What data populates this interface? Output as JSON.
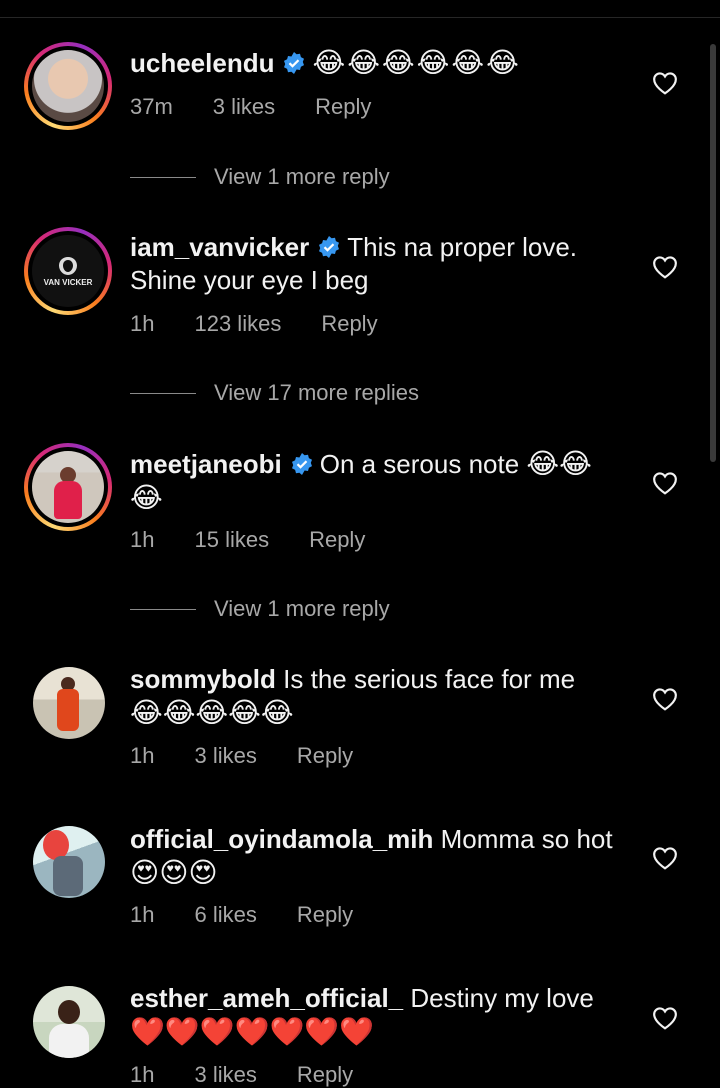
{
  "comments": [
    {
      "username": "ucheelendu",
      "verified": true,
      "text": "",
      "emojis": "😂😂😂😂😂😂",
      "time": "37m",
      "likes": "3 likes",
      "reply": "Reply",
      "view_more": "View 1 more reply"
    },
    {
      "username": "iam_vanvicker",
      "verified": true,
      "text": "This na proper love. Shine your eye I beg",
      "emojis": "",
      "time": "1h",
      "likes": "123 likes",
      "reply": "Reply",
      "view_more": "View 17 more replies",
      "avatar_text": "VAN VICKER"
    },
    {
      "username": "meetjaneobi",
      "verified": true,
      "text": "On a serous note",
      "emojis": "😂😂😂",
      "time": "1h",
      "likes": "15 likes",
      "reply": "Reply",
      "view_more": "View 1 more reply"
    },
    {
      "username": "sommybold",
      "verified": false,
      "text": "Is the serious face for me",
      "emojis": "😂😂😂😂😂",
      "time": "1h",
      "likes": "3 likes",
      "reply": "Reply"
    },
    {
      "username": "official_oyindamola_mih",
      "verified": false,
      "text": "Momma so hot",
      "emojis": "😍😍😍",
      "time": "1h",
      "likes": "6 likes",
      "reply": "Reply"
    },
    {
      "username": "esther_ameh_official_",
      "verified": false,
      "text": "Destiny my love",
      "emojis": "❤️❤️❤️❤️❤️❤️❤️",
      "time": "1h",
      "likes": "3 likes",
      "reply": "Reply"
    }
  ],
  "colors": {
    "background": "#000000",
    "text": "#f2f2f2",
    "secondary": "#a8a8a8",
    "verified": "#3797f0"
  }
}
